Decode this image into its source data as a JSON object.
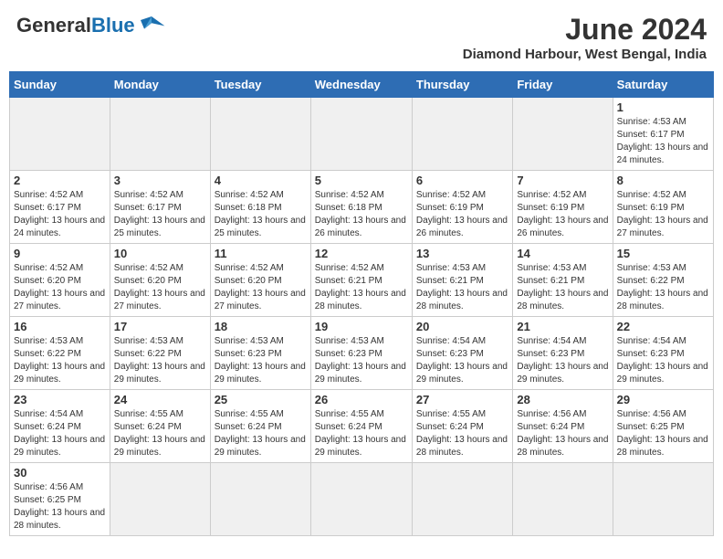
{
  "header": {
    "logo_general": "General",
    "logo_blue": "Blue",
    "month_year": "June 2024",
    "location": "Diamond Harbour, West Bengal, India"
  },
  "weekdays": [
    "Sunday",
    "Monday",
    "Tuesday",
    "Wednesday",
    "Thursday",
    "Friday",
    "Saturday"
  ],
  "weeks": [
    [
      {
        "day": "",
        "info": "",
        "empty": true
      },
      {
        "day": "",
        "info": "",
        "empty": true
      },
      {
        "day": "",
        "info": "",
        "empty": true
      },
      {
        "day": "",
        "info": "",
        "empty": true
      },
      {
        "day": "",
        "info": "",
        "empty": true
      },
      {
        "day": "",
        "info": "",
        "empty": true
      },
      {
        "day": "1",
        "info": "Sunrise: 4:53 AM\nSunset: 6:17 PM\nDaylight: 13 hours and 24 minutes."
      }
    ],
    [
      {
        "day": "2",
        "info": "Sunrise: 4:52 AM\nSunset: 6:17 PM\nDaylight: 13 hours and 24 minutes."
      },
      {
        "day": "3",
        "info": "Sunrise: 4:52 AM\nSunset: 6:17 PM\nDaylight: 13 hours and 25 minutes."
      },
      {
        "day": "4",
        "info": "Sunrise: 4:52 AM\nSunset: 6:18 PM\nDaylight: 13 hours and 25 minutes."
      },
      {
        "day": "5",
        "info": "Sunrise: 4:52 AM\nSunset: 6:18 PM\nDaylight: 13 hours and 26 minutes."
      },
      {
        "day": "6",
        "info": "Sunrise: 4:52 AM\nSunset: 6:19 PM\nDaylight: 13 hours and 26 minutes."
      },
      {
        "day": "7",
        "info": "Sunrise: 4:52 AM\nSunset: 6:19 PM\nDaylight: 13 hours and 26 minutes."
      },
      {
        "day": "8",
        "info": "Sunrise: 4:52 AM\nSunset: 6:19 PM\nDaylight: 13 hours and 27 minutes."
      }
    ],
    [
      {
        "day": "9",
        "info": "Sunrise: 4:52 AM\nSunset: 6:20 PM\nDaylight: 13 hours and 27 minutes."
      },
      {
        "day": "10",
        "info": "Sunrise: 4:52 AM\nSunset: 6:20 PM\nDaylight: 13 hours and 27 minutes."
      },
      {
        "day": "11",
        "info": "Sunrise: 4:52 AM\nSunset: 6:20 PM\nDaylight: 13 hours and 27 minutes."
      },
      {
        "day": "12",
        "info": "Sunrise: 4:52 AM\nSunset: 6:21 PM\nDaylight: 13 hours and 28 minutes."
      },
      {
        "day": "13",
        "info": "Sunrise: 4:53 AM\nSunset: 6:21 PM\nDaylight: 13 hours and 28 minutes."
      },
      {
        "day": "14",
        "info": "Sunrise: 4:53 AM\nSunset: 6:21 PM\nDaylight: 13 hours and 28 minutes."
      },
      {
        "day": "15",
        "info": "Sunrise: 4:53 AM\nSunset: 6:22 PM\nDaylight: 13 hours and 28 minutes."
      }
    ],
    [
      {
        "day": "16",
        "info": "Sunrise: 4:53 AM\nSunset: 6:22 PM\nDaylight: 13 hours and 29 minutes."
      },
      {
        "day": "17",
        "info": "Sunrise: 4:53 AM\nSunset: 6:22 PM\nDaylight: 13 hours and 29 minutes."
      },
      {
        "day": "18",
        "info": "Sunrise: 4:53 AM\nSunset: 6:23 PM\nDaylight: 13 hours and 29 minutes."
      },
      {
        "day": "19",
        "info": "Sunrise: 4:53 AM\nSunset: 6:23 PM\nDaylight: 13 hours and 29 minutes."
      },
      {
        "day": "20",
        "info": "Sunrise: 4:54 AM\nSunset: 6:23 PM\nDaylight: 13 hours and 29 minutes."
      },
      {
        "day": "21",
        "info": "Sunrise: 4:54 AM\nSunset: 6:23 PM\nDaylight: 13 hours and 29 minutes."
      },
      {
        "day": "22",
        "info": "Sunrise: 4:54 AM\nSunset: 6:23 PM\nDaylight: 13 hours and 29 minutes."
      }
    ],
    [
      {
        "day": "23",
        "info": "Sunrise: 4:54 AM\nSunset: 6:24 PM\nDaylight: 13 hours and 29 minutes."
      },
      {
        "day": "24",
        "info": "Sunrise: 4:55 AM\nSunset: 6:24 PM\nDaylight: 13 hours and 29 minutes."
      },
      {
        "day": "25",
        "info": "Sunrise: 4:55 AM\nSunset: 6:24 PM\nDaylight: 13 hours and 29 minutes."
      },
      {
        "day": "26",
        "info": "Sunrise: 4:55 AM\nSunset: 6:24 PM\nDaylight: 13 hours and 29 minutes."
      },
      {
        "day": "27",
        "info": "Sunrise: 4:55 AM\nSunset: 6:24 PM\nDaylight: 13 hours and 28 minutes."
      },
      {
        "day": "28",
        "info": "Sunrise: 4:56 AM\nSunset: 6:24 PM\nDaylight: 13 hours and 28 minutes."
      },
      {
        "day": "29",
        "info": "Sunrise: 4:56 AM\nSunset: 6:25 PM\nDaylight: 13 hours and 28 minutes."
      }
    ],
    [
      {
        "day": "30",
        "info": "Sunrise: 4:56 AM\nSunset: 6:25 PM\nDaylight: 13 hours and 28 minutes."
      },
      {
        "day": "",
        "info": "",
        "empty": true
      },
      {
        "day": "",
        "info": "",
        "empty": true
      },
      {
        "day": "",
        "info": "",
        "empty": true
      },
      {
        "day": "",
        "info": "",
        "empty": true
      },
      {
        "day": "",
        "info": "",
        "empty": true
      },
      {
        "day": "",
        "info": "",
        "empty": true
      }
    ]
  ]
}
